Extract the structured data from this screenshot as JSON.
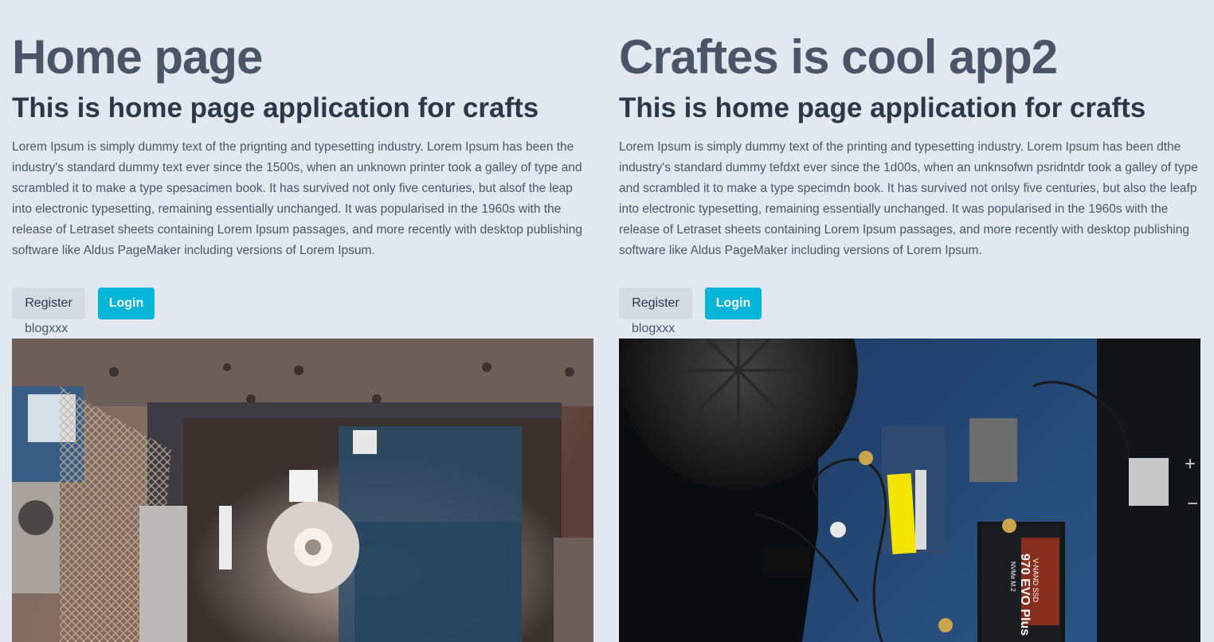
{
  "left": {
    "title": "Home page",
    "subtitle": "This is home page application for crafts",
    "body": "Lorem Ipsum is simply dummy text of the prignting and typesetting industry. Lorem Ipsum has been the industry's standard dummy text ever since the 1500s, when an unknown printer took a galley of type and scrambled it to make a type spesacimen book. It has survived not only five centuries, but alsof the leap into electronic typesetting, remaining essentially unchanged. It was popularised in the 1960s with the release of Letraset sheets containing Lorem Ipsum passages, and more recently with desktop publishing software like Aldus PageMaker including versions of Lorem Ipsum.",
    "register_label": "Register",
    "login_label": "Login",
    "blog_link": "blogxxx"
  },
  "right": {
    "title": "Craftes is cool app2",
    "subtitle": "This is home page application for crafts",
    "body": "Lorem Ipsum is simply dummy text of the printing and typesetting industry. Lorem Ipsum has been dthe industry's standard dummy tefdxt ever since the 1d00s, when an unknsofwn psridntdr took a galley of type and scrambled it to make a type specimdn book. It has survived not onlsy five centuries, but also the leafp into electronic typesetting, remaining essentially unchanged. It was popularised in the 1960s with the release of Letraset sheets containing Lorem Ipsum passages, and more recently with desktop publishing software like Aldus PageMaker including versions of Lorem Ipsum.",
    "register_label": "Register",
    "login_label": "Login",
    "blog_link": "blogxxx",
    "image_labels": {
      "ssd_brand": "V-NAND SSD",
      "ssd_model": "970 EVO Plus",
      "ssd_type": "NVMe M.2",
      "plus_sign": "+",
      "minus_sign": "−"
    }
  },
  "colors": {
    "background": "#e2e8f0",
    "title": "#4a5568",
    "subtitle": "#2d3748",
    "login_button": "#00b5d8",
    "register_button": "#d5dbe3"
  }
}
